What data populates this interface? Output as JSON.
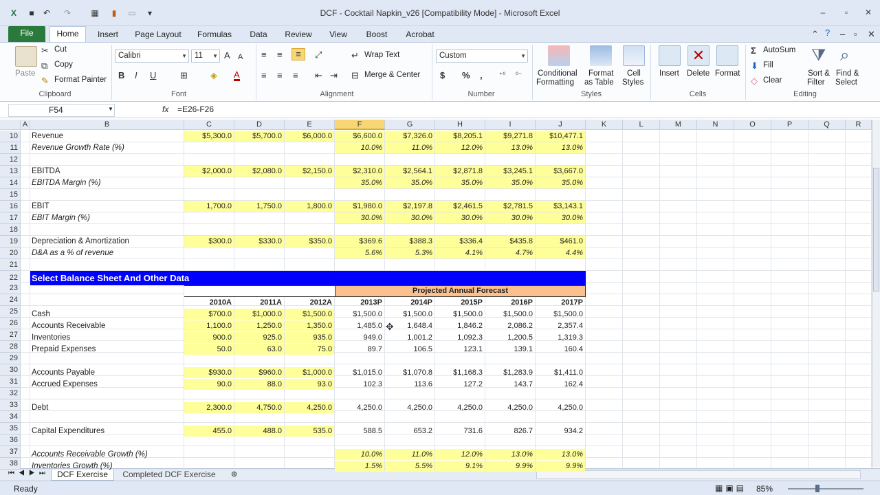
{
  "window": {
    "title": "DCF - Cocktail Napkin_v26  [Compatibility Mode]  -  Microsoft Excel"
  },
  "tabs": [
    "File",
    "Home",
    "Insert",
    "Page Layout",
    "Formulas",
    "Data",
    "Review",
    "View",
    "Boost",
    "Acrobat"
  ],
  "ribbon": {
    "clipboard": {
      "paste": "Paste",
      "cut": "Cut",
      "copy": "Copy",
      "format_painter": "Format Painter",
      "label": "Clipboard"
    },
    "font": {
      "name": "Calibri",
      "size": "11",
      "label": "Font"
    },
    "alignment": {
      "wrap": "Wrap Text",
      "merge": "Merge & Center",
      "label": "Alignment"
    },
    "number": {
      "format": "Custom",
      "label": "Number",
      "currency": "$",
      "percent": "%",
      "comma": ","
    },
    "styles": {
      "conditional_1": "Conditional",
      "conditional_2": "Formatting",
      "table_1": "Format",
      "table_2": "as Table",
      "cell_1": "Cell",
      "cell_2": "Styles",
      "label": "Styles"
    },
    "cells": {
      "insert": "Insert",
      "delete": "Delete",
      "format": "Format",
      "label": "Cells"
    },
    "editing": {
      "autosum": "AutoSum",
      "fill": "Fill",
      "clear": "Clear",
      "sort_1": "Sort &",
      "sort_2": "Filter",
      "find_1": "Find &",
      "find_2": "Select",
      "label": "Editing"
    }
  },
  "formula_bar": {
    "name_box": "F54",
    "fx": "fx",
    "formula": "=E26-F26"
  },
  "columns": [
    "A",
    "B",
    "C",
    "D",
    "E",
    "F",
    "G",
    "H",
    "I",
    "J",
    "K",
    "L",
    "M",
    "N",
    "O",
    "P",
    "Q",
    "R"
  ],
  "row_numbers": [
    "10",
    "11",
    "12",
    "13",
    "14",
    "15",
    "16",
    "17",
    "18",
    "19",
    "20",
    "21",
    "22",
    "23",
    "24",
    "25",
    "26",
    "27",
    "28",
    "29",
    "30",
    "31",
    "32",
    "33",
    "34",
    "35",
    "36",
    "37",
    "38"
  ],
  "rows": [
    {
      "label": "Revenue",
      "italic": false,
      "values": [
        "$5,300.0",
        "$5,700.0",
        "$6,000.0",
        "$6,600.0",
        "$7,326.0",
        "$8,205.1",
        "$9,271.8",
        "$10,477.1"
      ]
    },
    {
      "label": "Revenue Growth Rate (%)",
      "italic": true,
      "values": [
        "",
        "",
        "",
        "10.0%",
        "11.0%",
        "12.0%",
        "13.0%",
        "13.0%"
      ]
    },
    {
      "label": "",
      "values": []
    },
    {
      "label": "EBITDA",
      "italic": false,
      "values": [
        "$2,000.0",
        "$2,080.0",
        "$2,150.0",
        "$2,310.0",
        "$2,564.1",
        "$2,871.8",
        "$3,245.1",
        "$3,667.0"
      ]
    },
    {
      "label": "EBITDA Margin (%)",
      "italic": true,
      "values": [
        "",
        "",
        "",
        "35.0%",
        "35.0%",
        "35.0%",
        "35.0%",
        "35.0%"
      ]
    },
    {
      "label": "",
      "values": []
    },
    {
      "label": "EBIT",
      "italic": false,
      "values": [
        "1,700.0",
        "1,750.0",
        "1,800.0",
        "$1,980.0",
        "$2,197.8",
        "$2,461.5",
        "$2,781.5",
        "$3,143.1"
      ]
    },
    {
      "label": "EBIT Margin (%)",
      "italic": true,
      "values": [
        "",
        "",
        "",
        "30.0%",
        "30.0%",
        "30.0%",
        "30.0%",
        "30.0%"
      ]
    },
    {
      "label": "",
      "values": []
    },
    {
      "label": "Depreciation & Amortization",
      "italic": false,
      "values": [
        "$300.0",
        "$330.0",
        "$350.0",
        "$369.6",
        "$388.3",
        "$336.4",
        "$435.8",
        "$461.0"
      ]
    },
    {
      "label": "D&A as a % of revenue",
      "italic": true,
      "values": [
        "",
        "",
        "",
        "5.6%",
        "5.3%",
        "4.1%",
        "4.7%",
        "4.4%"
      ]
    },
    {
      "label": "",
      "values": []
    }
  ],
  "section_title": "Select Balance Sheet And Other Data",
  "forecast_header": "Projected Annual Forecast",
  "years": [
    "2010A",
    "2011A",
    "2012A",
    "2013P",
    "2014P",
    "2015P",
    "2016P",
    "2017P"
  ],
  "bs_rows": [
    {
      "label": "Cash",
      "italic": false,
      "values": [
        "$700.0",
        "$1,000.0",
        "$1,500.0",
        "$1,500.0",
        "$1,500.0",
        "$1,500.0",
        "$1,500.0",
        "$1,500.0"
      ]
    },
    {
      "label": "Accounts Receivable",
      "italic": false,
      "values": [
        "1,100.0",
        "1,250.0",
        "1,350.0",
        "1,485.0",
        "1,648.4",
        "1,846.2",
        "2,086.2",
        "2,357.4"
      ]
    },
    {
      "label": "Inventories",
      "italic": false,
      "values": [
        "900.0",
        "925.0",
        "935.0",
        "949.0",
        "1,001.2",
        "1,092.3",
        "1,200.5",
        "1,319.3"
      ]
    },
    {
      "label": "Prepaid Expenses",
      "italic": false,
      "values": [
        "50.0",
        "63.0",
        "75.0",
        "89.7",
        "106.5",
        "123.1",
        "139.1",
        "160.4"
      ]
    },
    {
      "label": "",
      "values": []
    },
    {
      "label": "Accounts Payable",
      "italic": false,
      "values": [
        "$930.0",
        "$960.0",
        "$1,000.0",
        "$1,015.0",
        "$1,070.8",
        "$1,168.3",
        "$1,283.9",
        "$1,411.0"
      ]
    },
    {
      "label": "Accrued Expenses",
      "italic": false,
      "values": [
        "90.0",
        "88.0",
        "93.0",
        "102.3",
        "113.6",
        "127.2",
        "143.7",
        "162.4"
      ]
    },
    {
      "label": "",
      "values": []
    },
    {
      "label": "Debt",
      "italic": false,
      "values": [
        "2,300.0",
        "4,750.0",
        "4,250.0",
        "4,250.0",
        "4,250.0",
        "4,250.0",
        "4,250.0",
        "4,250.0"
      ]
    },
    {
      "label": "",
      "values": []
    },
    {
      "label": "Capital Expenditures",
      "italic": false,
      "values": [
        "455.0",
        "488.0",
        "535.0",
        "588.5",
        "653.2",
        "731.6",
        "826.7",
        "934.2"
      ]
    },
    {
      "label": "",
      "values": []
    },
    {
      "label": "Accounts Receivable Growth (%)",
      "italic": true,
      "values": [
        "",
        "",
        "",
        "10.0%",
        "11.0%",
        "12.0%",
        "13.0%",
        "13.0%"
      ]
    },
    {
      "label": "Inventories Growth (%)",
      "italic": true,
      "values": [
        "",
        "",
        "",
        "1.5%",
        "5.5%",
        "9.1%",
        "9.9%",
        "9.9%"
      ]
    }
  ],
  "sheet_tabs": [
    "DCF Exercise",
    "Completed DCF Exercise"
  ],
  "status": {
    "text": "Ready",
    "zoom": "85%"
  },
  "colors": {
    "yellow": "#ffff99",
    "section_blue": "#0000ff",
    "forecast_orange": "#fac090",
    "file_green": "#2a7a3b"
  }
}
